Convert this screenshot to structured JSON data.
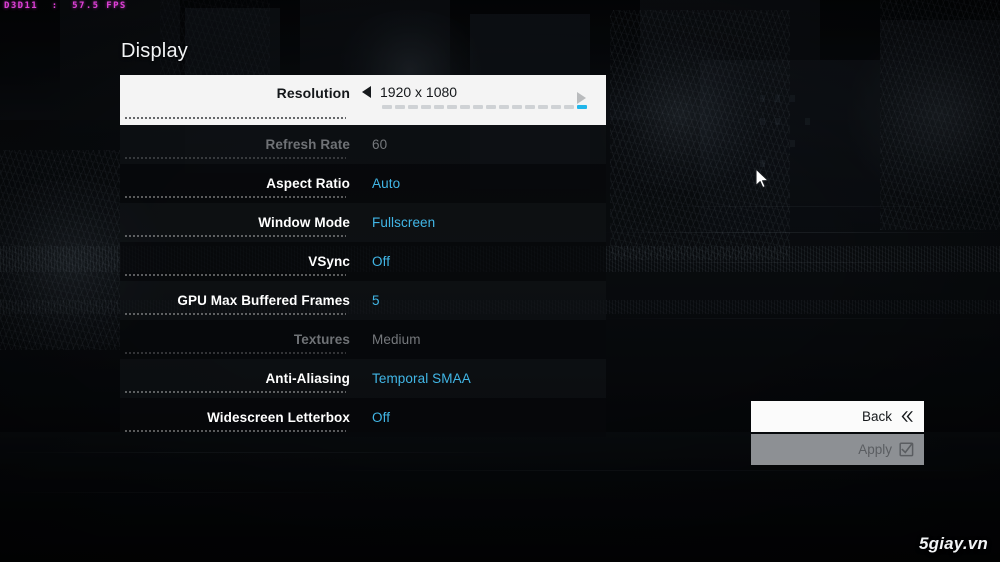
{
  "hud": {
    "text": "D3D11  :  57.5 FPS",
    "color": "#e040d8"
  },
  "menu": {
    "title": "Display",
    "rows": [
      {
        "label": "Resolution",
        "value": "1920 x 1080",
        "state": "selected",
        "control": "slider",
        "segments": 16,
        "active_segment": 16,
        "left_arrow": "arrow-left",
        "right_arrow": "arrow-right"
      },
      {
        "label": "Refresh Rate",
        "value": "60",
        "state": "disabled",
        "control": "text"
      },
      {
        "label": "Aspect Ratio",
        "value": "Auto",
        "state": "enabled",
        "control": "text"
      },
      {
        "label": "Window Mode",
        "value": "Fullscreen",
        "state": "enabled",
        "control": "text"
      },
      {
        "label": "VSync",
        "value": "Off",
        "state": "enabled",
        "control": "text"
      },
      {
        "label": "GPU Max Buffered Frames",
        "value": "5",
        "state": "enabled",
        "control": "text"
      },
      {
        "label": "Textures",
        "value": "Medium",
        "state": "disabled",
        "control": "text"
      },
      {
        "label": "Anti-Aliasing",
        "value": "Temporal SMAA",
        "state": "enabled",
        "control": "text"
      },
      {
        "label": "Widescreen Letterbox",
        "value": "Off",
        "state": "enabled",
        "control": "text"
      }
    ]
  },
  "buttons": {
    "back": {
      "label": "Back",
      "icon": "double-chevron-left-icon"
    },
    "apply": {
      "label": "Apply",
      "icon": "checkbox-checked-icon",
      "state": "disabled"
    }
  },
  "watermark": {
    "text": "5giay.vn"
  },
  "colors": {
    "value_cyan": "#41b6e6",
    "slider_active": "#21b6ea",
    "panel_selected_bg": "#f4f4f4",
    "apply_bg": "#8d9094",
    "hud_magenta": "#e040d8"
  }
}
